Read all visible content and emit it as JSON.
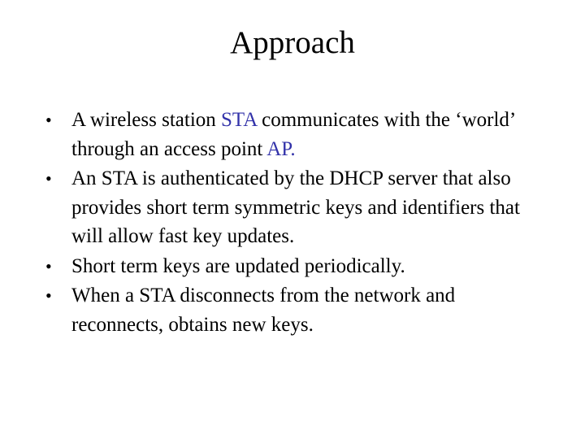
{
  "slide": {
    "title": "Approach",
    "bullet_symbol": "•",
    "highlight_color": "#3333aa",
    "bullets": [
      {
        "segments": [
          {
            "text": "A wireless station ",
            "highlight": false
          },
          {
            "text": "STA",
            "highlight": true
          },
          {
            "text": " communicates with the ‘world’ through an access point ",
            "highlight": false
          },
          {
            "text": "AP.",
            "highlight": true
          }
        ]
      },
      {
        "segments": [
          {
            "text": "An STA is authenticated by the DHCP server that also provides short term symmetric keys and identifiers that will allow fast key updates.",
            "highlight": false
          }
        ]
      },
      {
        "segments": [
          {
            "text": "Short term keys are updated periodically.",
            "highlight": false
          }
        ]
      },
      {
        "segments": [
          {
            "text": "When a STA disconnects from the network and reconnects, obtains new keys.",
            "highlight": false
          }
        ]
      }
    ]
  }
}
